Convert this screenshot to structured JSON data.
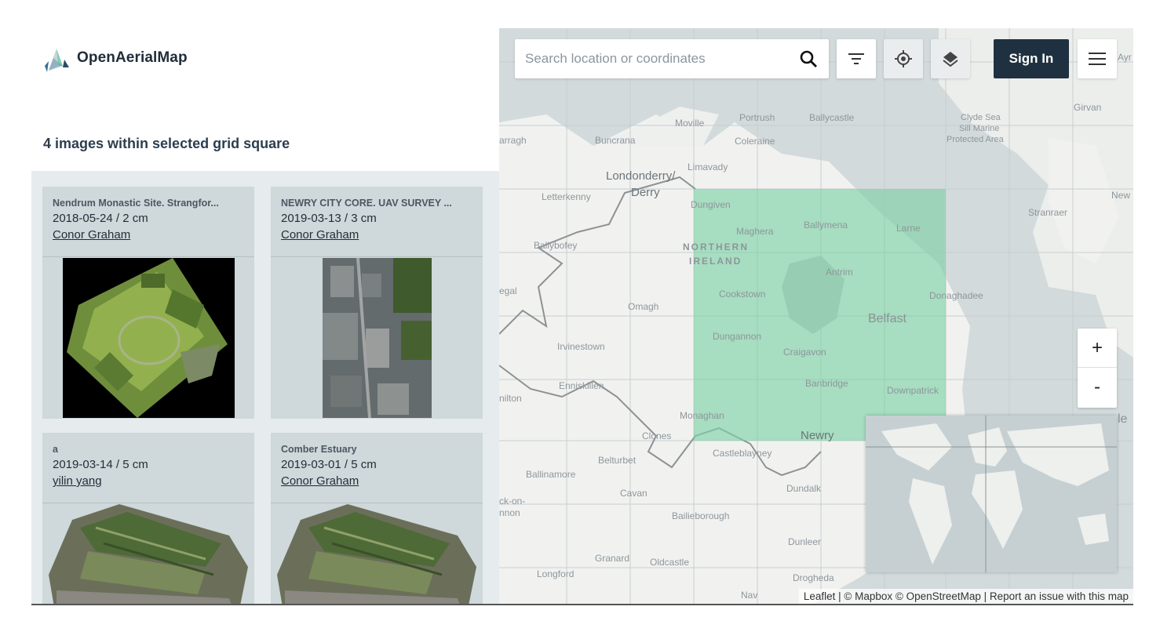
{
  "brand": {
    "name": "OpenAerialMap"
  },
  "results": {
    "title": "4 images within selected grid square",
    "items": [
      {
        "title": "Nendrum Monastic Site. Strangfor...",
        "meta": "2018-05-24 / 2 cm",
        "author": "Conor Graham"
      },
      {
        "title": "NEWRY CITY CORE. UAV SURVEY ...",
        "meta": "2019-03-13 / 3 cm",
        "author": "Conor Graham"
      },
      {
        "title": "a",
        "meta": "2019-03-14 / 5 cm",
        "author": "yilin yang"
      },
      {
        "title": "Comber Estuary",
        "meta": "2019-03-01 / 5 cm",
        "author": "Conor Graham"
      }
    ]
  },
  "toolbar": {
    "search_placeholder": "Search location or coordinates",
    "search_icon": "search-icon",
    "filter_icon": "filter-icon",
    "locate_icon": "locate-icon",
    "layers_icon": "layers-icon",
    "signin_label": "Sign In",
    "menu_icon": "hamburger-icon"
  },
  "zoom": {
    "in_label": "+",
    "out_label": "-"
  },
  "attribution": "Leaflet | © Mapbox © OpenStreetMap | Report an issue with this map",
  "map_labels": {
    "northern_ireland": "NORTHERN",
    "northern_ireland_2": "IRELAND",
    "londonderry": "Londonderry/",
    "derry": "Derry",
    "belfast": "Belfast",
    "newry": "Newry",
    "omagh": "Omagh",
    "enniskillen": "Enniskillen",
    "irvinestown": "Irvinestown",
    "letterkenny": "Letterkenny",
    "ballybofey": "Ballybofey",
    "buncrana": "Buncrana",
    "moville": "Moville",
    "portrush": "Portrush",
    "ballycastle": "Ballycastle",
    "coleraine": "Coleraine",
    "limavady": "Limavady",
    "dungiven": "Dungiven",
    "maghera": "Maghera",
    "ballymena": "Ballymena",
    "larne": "Larne",
    "antrim": "Antrim",
    "cookstown": "Cookstown",
    "dungannon": "Dungannon",
    "craigavon": "Craigavon",
    "banbridge": "Banbridge",
    "downpatrick": "Downpatrick",
    "donaghadee": "Donaghadee",
    "monaghan": "Monaghan",
    "clones": "Clones",
    "castleblayney": "Castleblayney",
    "belturbet": "Belturbet",
    "ballinamore": "Ballinamore",
    "cavan": "Cavan",
    "dundalk": "Dundalk",
    "bailieborough": "Bailieborough",
    "dunleer": "Dunleer",
    "granard": "Granard",
    "oldcastle": "Oldcastle",
    "longford": "Longford",
    "drogheda": "Drogheda",
    "stranraer": "Stranraer",
    "girvan": "Girvan",
    "clyde": "Clyde Sea",
    "clyde2": "Sill Marine",
    "clyde3": "Protected Area",
    "arragh": "arragh",
    "egal": "egal",
    "nilton": "nilton",
    "ckon": "ck-on-",
    "nnon": "nnon",
    "new": "New",
    "ayr": "Ayr",
    "le": "le",
    "nav": "Nav"
  },
  "colors": {
    "selection": "#7fd1a6",
    "signin_bg": "#1f3140",
    "panel_bg": "#e6ebed",
    "card_bg": "#cfd8da"
  }
}
